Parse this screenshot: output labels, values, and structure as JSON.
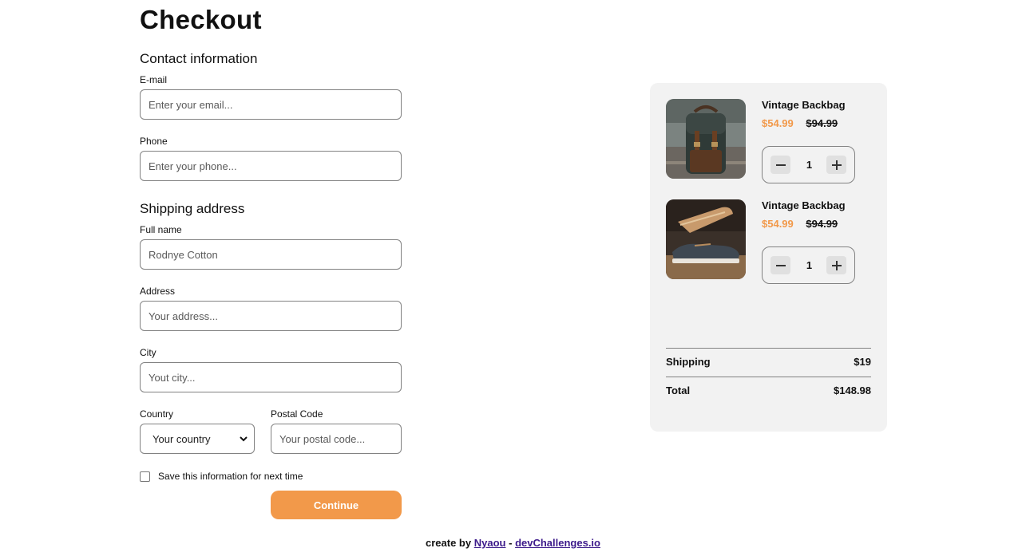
{
  "page": {
    "title": "Checkout"
  },
  "contact": {
    "heading": "Contact information",
    "email": {
      "label": "E-mail",
      "placeholder": "Enter your email...",
      "value": ""
    },
    "phone": {
      "label": "Phone",
      "placeholder": "Enter your phone...",
      "value": ""
    }
  },
  "shipping": {
    "heading": "Shipping address",
    "full_name": {
      "label": "Full name",
      "placeholder": "Rodnye Cotton",
      "value": ""
    },
    "address": {
      "label": "Address",
      "placeholder": "Your address...",
      "value": ""
    },
    "city": {
      "label": "City",
      "placeholder": "Yout city...",
      "value": ""
    },
    "country": {
      "label": "Country",
      "selected": "Your country"
    },
    "postal": {
      "label": "Postal Code",
      "placeholder": "Your postal code...",
      "value": ""
    }
  },
  "save_info": {
    "label": "Save this information for next time",
    "checked": false
  },
  "continue_label": "Continue",
  "cart": {
    "items": [
      {
        "name": "Vintage Backbag",
        "price": "$54.99",
        "old_price": "$94.99",
        "quantity": "1",
        "image": "backpack-photo"
      },
      {
        "name": "Vintage Backbag",
        "price": "$54.99",
        "old_price": "$94.99",
        "quantity": "1",
        "image": "shoes-photo"
      }
    ],
    "shipping_label": "Shipping",
    "shipping_value": "$19",
    "total_label": "Total",
    "total_value": "$148.98"
  },
  "footer": {
    "prefix": "create by",
    "author": "Nyaou",
    "separator": "-",
    "site": "devChallenges.io"
  },
  "colors": {
    "accent": "#f2994a",
    "panel_bg": "#f2f2f2",
    "border": "#828282",
    "link": "#3c1a8a"
  }
}
